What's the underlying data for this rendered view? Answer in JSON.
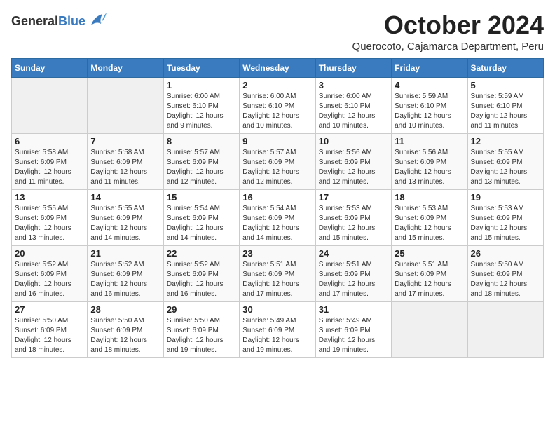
{
  "header": {
    "logo_general": "General",
    "logo_blue": "Blue",
    "month_title": "October 2024",
    "location": "Querocoto, Cajamarca Department, Peru"
  },
  "calendar": {
    "days_of_week": [
      "Sunday",
      "Monday",
      "Tuesday",
      "Wednesday",
      "Thursday",
      "Friday",
      "Saturday"
    ],
    "weeks": [
      [
        {
          "day": "",
          "info": ""
        },
        {
          "day": "",
          "info": ""
        },
        {
          "day": "1",
          "info": "Sunrise: 6:00 AM\nSunset: 6:10 PM\nDaylight: 12 hours and 9 minutes."
        },
        {
          "day": "2",
          "info": "Sunrise: 6:00 AM\nSunset: 6:10 PM\nDaylight: 12 hours and 10 minutes."
        },
        {
          "day": "3",
          "info": "Sunrise: 6:00 AM\nSunset: 6:10 PM\nDaylight: 12 hours and 10 minutes."
        },
        {
          "day": "4",
          "info": "Sunrise: 5:59 AM\nSunset: 6:10 PM\nDaylight: 12 hours and 10 minutes."
        },
        {
          "day": "5",
          "info": "Sunrise: 5:59 AM\nSunset: 6:10 PM\nDaylight: 12 hours and 11 minutes."
        }
      ],
      [
        {
          "day": "6",
          "info": "Sunrise: 5:58 AM\nSunset: 6:09 PM\nDaylight: 12 hours and 11 minutes."
        },
        {
          "day": "7",
          "info": "Sunrise: 5:58 AM\nSunset: 6:09 PM\nDaylight: 12 hours and 11 minutes."
        },
        {
          "day": "8",
          "info": "Sunrise: 5:57 AM\nSunset: 6:09 PM\nDaylight: 12 hours and 12 minutes."
        },
        {
          "day": "9",
          "info": "Sunrise: 5:57 AM\nSunset: 6:09 PM\nDaylight: 12 hours and 12 minutes."
        },
        {
          "day": "10",
          "info": "Sunrise: 5:56 AM\nSunset: 6:09 PM\nDaylight: 12 hours and 12 minutes."
        },
        {
          "day": "11",
          "info": "Sunrise: 5:56 AM\nSunset: 6:09 PM\nDaylight: 12 hours and 13 minutes."
        },
        {
          "day": "12",
          "info": "Sunrise: 5:55 AM\nSunset: 6:09 PM\nDaylight: 12 hours and 13 minutes."
        }
      ],
      [
        {
          "day": "13",
          "info": "Sunrise: 5:55 AM\nSunset: 6:09 PM\nDaylight: 12 hours and 13 minutes."
        },
        {
          "day": "14",
          "info": "Sunrise: 5:55 AM\nSunset: 6:09 PM\nDaylight: 12 hours and 14 minutes."
        },
        {
          "day": "15",
          "info": "Sunrise: 5:54 AM\nSunset: 6:09 PM\nDaylight: 12 hours and 14 minutes."
        },
        {
          "day": "16",
          "info": "Sunrise: 5:54 AM\nSunset: 6:09 PM\nDaylight: 12 hours and 14 minutes."
        },
        {
          "day": "17",
          "info": "Sunrise: 5:53 AM\nSunset: 6:09 PM\nDaylight: 12 hours and 15 minutes."
        },
        {
          "day": "18",
          "info": "Sunrise: 5:53 AM\nSunset: 6:09 PM\nDaylight: 12 hours and 15 minutes."
        },
        {
          "day": "19",
          "info": "Sunrise: 5:53 AM\nSunset: 6:09 PM\nDaylight: 12 hours and 15 minutes."
        }
      ],
      [
        {
          "day": "20",
          "info": "Sunrise: 5:52 AM\nSunset: 6:09 PM\nDaylight: 12 hours and 16 minutes."
        },
        {
          "day": "21",
          "info": "Sunrise: 5:52 AM\nSunset: 6:09 PM\nDaylight: 12 hours and 16 minutes."
        },
        {
          "day": "22",
          "info": "Sunrise: 5:52 AM\nSunset: 6:09 PM\nDaylight: 12 hours and 16 minutes."
        },
        {
          "day": "23",
          "info": "Sunrise: 5:51 AM\nSunset: 6:09 PM\nDaylight: 12 hours and 17 minutes."
        },
        {
          "day": "24",
          "info": "Sunrise: 5:51 AM\nSunset: 6:09 PM\nDaylight: 12 hours and 17 minutes."
        },
        {
          "day": "25",
          "info": "Sunrise: 5:51 AM\nSunset: 6:09 PM\nDaylight: 12 hours and 17 minutes."
        },
        {
          "day": "26",
          "info": "Sunrise: 5:50 AM\nSunset: 6:09 PM\nDaylight: 12 hours and 18 minutes."
        }
      ],
      [
        {
          "day": "27",
          "info": "Sunrise: 5:50 AM\nSunset: 6:09 PM\nDaylight: 12 hours and 18 minutes."
        },
        {
          "day": "28",
          "info": "Sunrise: 5:50 AM\nSunset: 6:09 PM\nDaylight: 12 hours and 18 minutes."
        },
        {
          "day": "29",
          "info": "Sunrise: 5:50 AM\nSunset: 6:09 PM\nDaylight: 12 hours and 19 minutes."
        },
        {
          "day": "30",
          "info": "Sunrise: 5:49 AM\nSunset: 6:09 PM\nDaylight: 12 hours and 19 minutes."
        },
        {
          "day": "31",
          "info": "Sunrise: 5:49 AM\nSunset: 6:09 PM\nDaylight: 12 hours and 19 minutes."
        },
        {
          "day": "",
          "info": ""
        },
        {
          "day": "",
          "info": ""
        }
      ]
    ]
  }
}
